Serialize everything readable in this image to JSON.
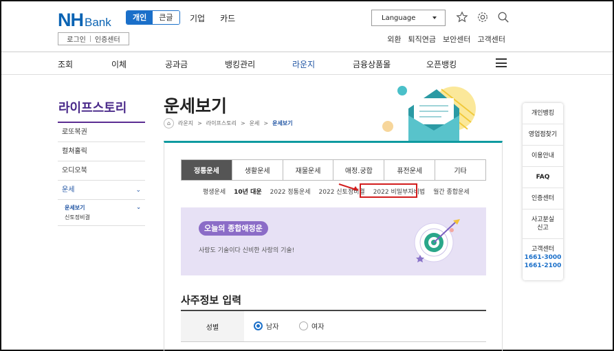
{
  "header": {
    "logo_nh": "NH",
    "logo_bank": "Bank",
    "segment": [
      "개인",
      "큰글"
    ],
    "nav": [
      "기업",
      "카드"
    ],
    "language": "Language",
    "login": "로그인",
    "cert": "인증센터",
    "util_links": [
      "외환",
      "퇴직연금",
      "보안센터",
      "고객센터"
    ]
  },
  "gnb": [
    "조회",
    "이체",
    "공과금",
    "뱅킹관리",
    "라운지",
    "금융상품몰",
    "오픈뱅킹"
  ],
  "lnb": {
    "title": "라이프스토리",
    "items": [
      "로또복권",
      "컬쳐홀릭",
      "오디오북",
      "운세"
    ],
    "sub_selected": "운세보기",
    "sub_other": "신토정비결"
  },
  "page": {
    "title": "운세보기",
    "breadcrumb": [
      "라운지",
      "라이프스토리",
      "운세",
      "운세보기"
    ]
  },
  "tabs": [
    "정통운세",
    "생활운세",
    "재물운세",
    "애정.궁합",
    "퓨전운세",
    "기타"
  ],
  "subtabs": [
    "평생운세",
    "10년 대운",
    "2022 정통운세",
    "2022 신토정비결",
    "2022 비밀부자비법",
    "월간 종합운세"
  ],
  "banner": {
    "badge": "오늘의 종합애정운",
    "desc": "사랑도 기술이다 신비한 사랑의 기술!"
  },
  "form": {
    "section_title": "사주정보 입력",
    "gender_label": "성별",
    "male": "남자",
    "female": "여자"
  },
  "quick": {
    "items": [
      "개인뱅킹",
      "영업점찾기",
      "이용안내",
      "FAQ",
      "인증센터"
    ],
    "lost_1": "사고분실",
    "lost_2": "신고",
    "cs": "고객센터",
    "tel1": "1661-3000",
    "tel2": "1661-2100"
  },
  "colors": {
    "brand": "#0a63b3",
    "accent": "#0f9aa0",
    "highlight": "#d21c1c",
    "lnb": "#5a2c91"
  }
}
